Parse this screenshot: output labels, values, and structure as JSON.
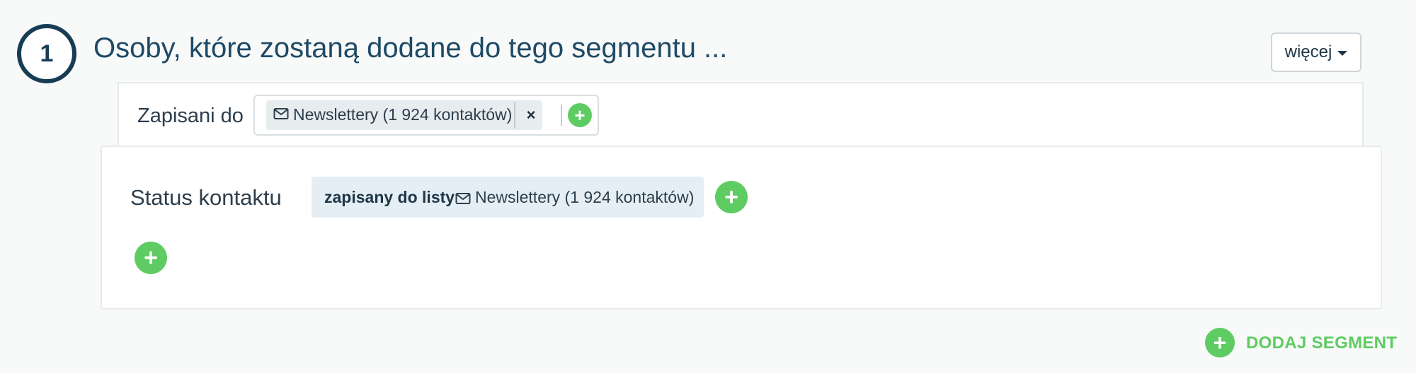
{
  "step": {
    "number": "1",
    "title": "Osoby, które zostaną dodane do tego segmentu ..."
  },
  "more_button": {
    "label": "więcej",
    "icon": "caret-down-icon"
  },
  "subscribed": {
    "label": "Zapisani do",
    "chip": {
      "icon": "envelope-icon",
      "text": "Newslettery (1 924 kontaktów)",
      "remove": "×"
    },
    "add_icon": "plus-icon"
  },
  "status": {
    "label": "Status kontaktu",
    "chip": {
      "state": "zapisany do listy",
      "icon": "envelope-icon",
      "list": "Newslettery (1 924 kontaktów)"
    },
    "add_icon": "plus-icon"
  },
  "add_condition_icon": "plus-icon",
  "add_segment": {
    "label": "DODAJ SEGMENT",
    "icon": "plus-icon"
  },
  "colors": {
    "primary": "#1e4a66",
    "accent_green": "#5ecc62",
    "chip_bg": "#e7ecef",
    "status_chip_bg": "#e5eef4"
  }
}
